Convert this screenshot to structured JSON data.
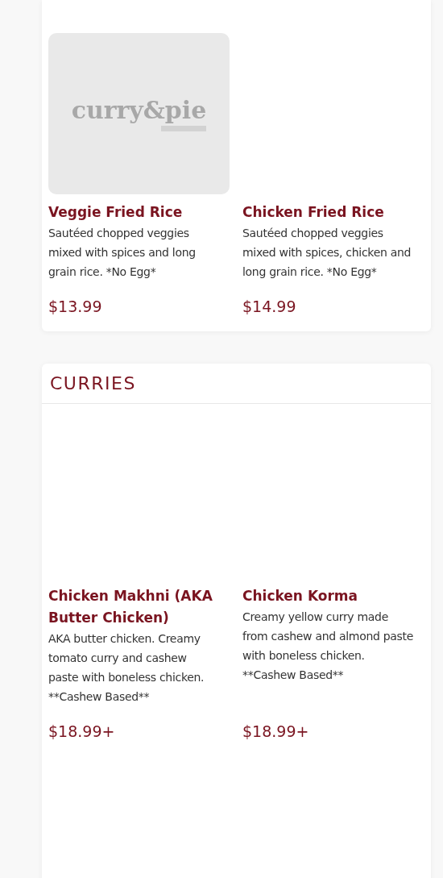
{
  "sections": [
    {
      "items": [
        {
          "name": "Veggie Fried Rice",
          "description": "Sautéed chopped veggies mixed with spices and long grain rice. *No Egg*",
          "price": "$13.99",
          "image": {
            "kind": "logo",
            "text": "curry&pie"
          }
        },
        {
          "name": "Chicken Fried Rice",
          "description": "Sautéed chopped veggies mixed with spices, chicken and long grain rice. *No Egg*",
          "price": "$14.99"
        }
      ]
    },
    {
      "title": "CURRIES",
      "items": [
        {
          "name": "Chicken Makhni (AKA Butter Chicken)",
          "description": "AKA butter chicken. Creamy tomato curry and cashew paste with boneless chicken. **Cashew Based**",
          "price": "$18.99+"
        },
        {
          "name": "Chicken Korma",
          "description": "Creamy yellow curry made from cashew and almond paste with boneless chicken. **Cashew Based**",
          "price": "$18.99+"
        }
      ]
    }
  ]
}
